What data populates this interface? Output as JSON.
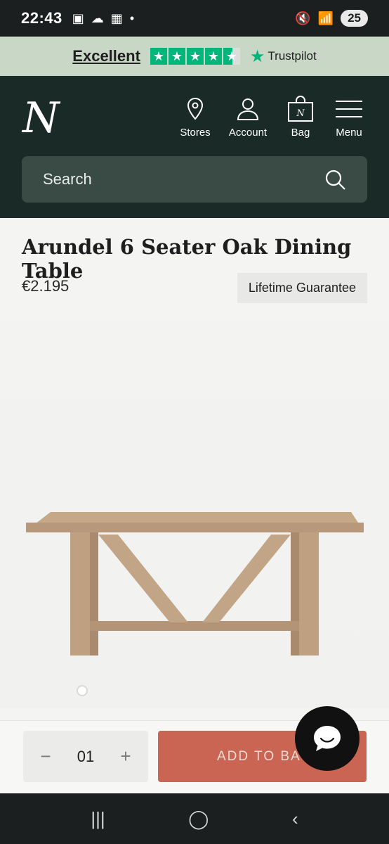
{
  "status_bar": {
    "time": "22:43",
    "battery": "25"
  },
  "trust_banner": {
    "rating_text": "Excellent",
    "brand": "Trustpilot",
    "stars": 4.5
  },
  "header": {
    "logo": "N",
    "nav": [
      {
        "label": "Stores",
        "icon": "location-pin-icon"
      },
      {
        "label": "Account",
        "icon": "user-icon"
      },
      {
        "label": "Bag",
        "icon": "shopping-bag-icon"
      },
      {
        "label": "Menu",
        "icon": "hamburger-menu-icon"
      }
    ],
    "search_placeholder": "Search"
  },
  "product": {
    "title": "Arundel 6 Seater Oak Dining Table",
    "price": "€2.195",
    "badge": "Lifetime Guarantee"
  },
  "purchase": {
    "quantity": "01",
    "minus": "−",
    "plus": "+",
    "add_to_bag": "ADD TO BAG"
  },
  "colors": {
    "header_bg": "#1a2a26",
    "search_bg": "#3a4b46",
    "trust_banner_bg": "#c8d7c6",
    "trustpilot_green": "#00b67a",
    "cta_bg": "#c96552"
  }
}
